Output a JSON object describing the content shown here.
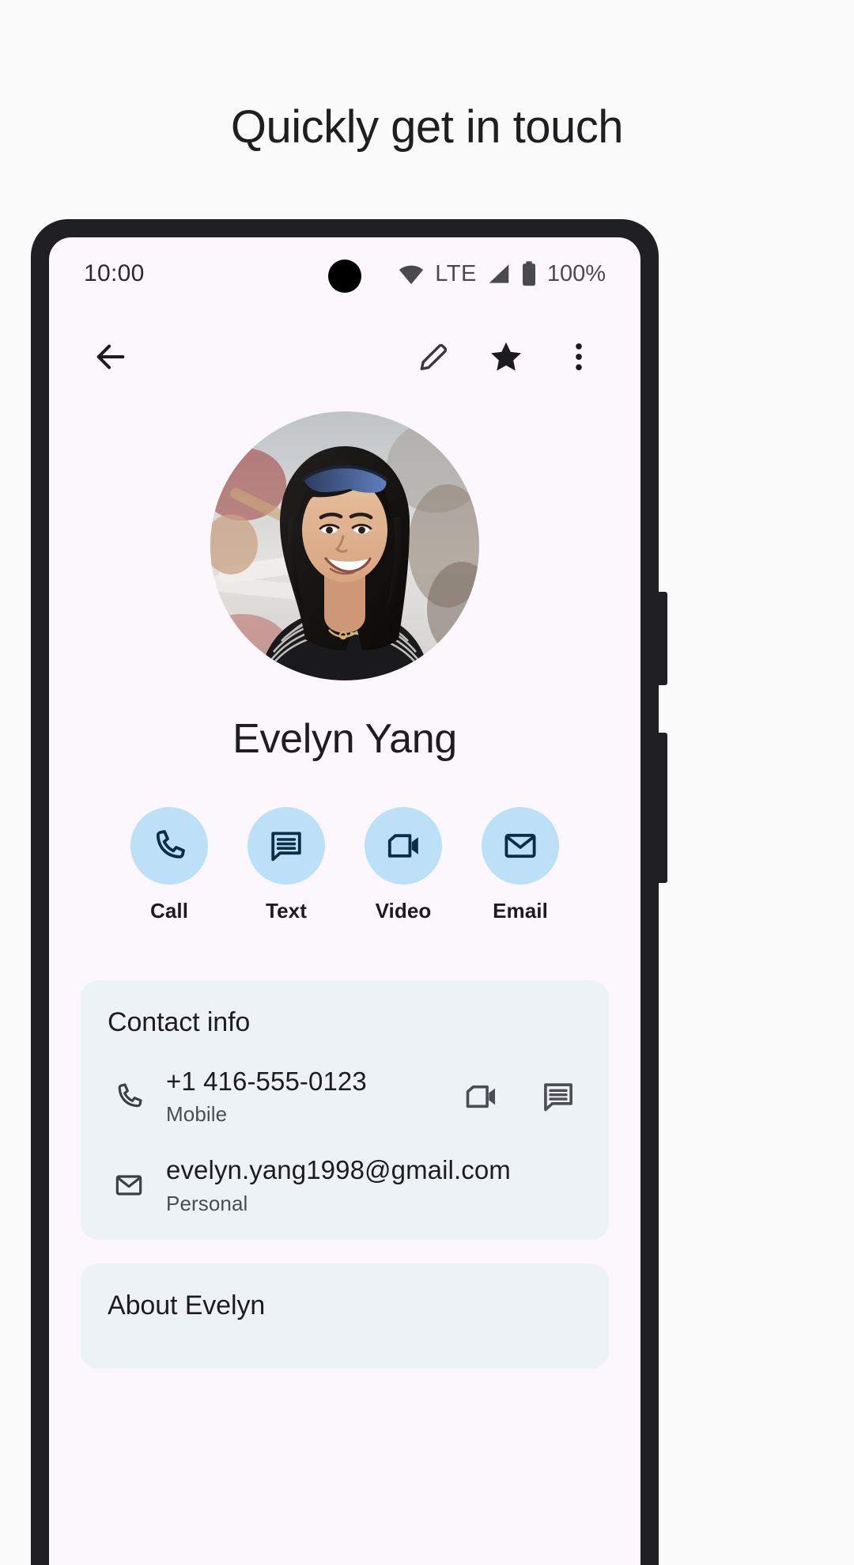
{
  "page": {
    "headline": "Quickly get in touch",
    "background": "#FAFAFA"
  },
  "phone": {
    "screen_background": "#FCF7FC",
    "frame_color": "#201F22",
    "hardware_buttons": [
      "power-button",
      "volume-rocker"
    ]
  },
  "status_bar": {
    "time": "10:00",
    "wifi_icon": "wifi-icon",
    "network_label": "LTE",
    "signal_icon": "signal-bars-icon",
    "battery_icon": "battery-full-icon",
    "battery_percent": "100%",
    "camera_icon": "front-camera-punchhole"
  },
  "app_bar": {
    "back_icon": "back-arrow-icon",
    "edit_icon": "pencil-edit-icon",
    "favorite_icon": "star-filled-icon",
    "overflow_icon": "more-vertical-icon"
  },
  "profile": {
    "avatar_name": "contact-avatar-photo",
    "name": "Evelyn Yang"
  },
  "quick_actions": [
    {
      "label": "Call",
      "icon": "phone-icon"
    },
    {
      "label": "Text",
      "icon": "message-icon"
    },
    {
      "label": "Video",
      "icon": "video-camera-icon"
    },
    {
      "label": "Email",
      "icon": "envelope-icon"
    }
  ],
  "contact_info": {
    "title": "Contact info",
    "rows": [
      {
        "icon": "phone-icon",
        "primary": "+1 416-555-0123",
        "secondary": "Mobile",
        "trailing": [
          "video-camera-icon",
          "message-icon"
        ]
      },
      {
        "icon": "envelope-icon",
        "primary": "evelyn.yang1998@gmail.com",
        "secondary": "Personal",
        "trailing": []
      }
    ]
  },
  "about_card": {
    "title": "About Evelyn"
  },
  "colors": {
    "accent_circle": "#BCE0F8",
    "accent_icon": "#0C2D48",
    "card_background": "#EDF2F7",
    "text_primary": "#1D1D20",
    "text_secondary": "#4A4E54"
  }
}
